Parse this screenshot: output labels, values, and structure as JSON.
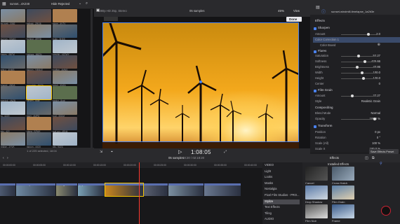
{
  "browser": {
    "title": "Hide Rejected",
    "clips_label": "sunset...4XZ48",
    "footer": "1 of 225 selected, 18:04",
    "thumb_labels": [
      "lsr-park...3382",
      "fallbdd...ZRQ8",
      "stone...4VTV",
      "la-nym...SSMG",
      "forbidd...8RRD",
      "trollp...9HSS",
      "hayes...4NFM",
      "highwa...M8ZN",
      "creshin...4ZZWY",
      "arts-c...4NMS",
      "lagoon...HANLE",
      "rooftop...4MNS",
      "chapel...4NDA",
      "mountain...4NZA",
      "cresh...4NZA",
      "gondoli...4NZB",
      "lunden...8ugt",
      "tundcr...8ugt",
      "lo...42Z9",
      "laser...4MPD",
      "roof...3SDM",
      "sky...4ZY",
      "plaza...SZWX",
      "surf-ocr...4RN4",
      "bridge...1YVK",
      "lagoon...44CK",
      "city...9ZZC"
    ]
  },
  "viewer": {
    "format": "1080p HD 25p, Stereo",
    "project": "05 samples",
    "zoom": "45%",
    "view": "View",
    "done": "Done",
    "timecode": "1:08:05"
  },
  "inspector": {
    "clip_name": "sunset-windmill-timelapse_1a2b3e",
    "sections": {
      "effects": "Effects",
      "sharpen": "Sharpen",
      "color_correction": "Color Correction 1",
      "color_board": "Color Board",
      "flares": "Flares",
      "film_grain": "Film Grain",
      "compositing": "Compositing",
      "transform": "Transform"
    },
    "rows": {
      "amount": "Amount",
      "amount_v": "2.0",
      "saturation": "Saturation",
      "saturation_v": "52.27",
      "softness": "Softness",
      "softness_v": "425.66",
      "brightness": "Brightness",
      "brightness_v": "43.86",
      "width": "Width",
      "width_v": "100.0",
      "height": "Height",
      "height_v": "120.0",
      "center": "Center",
      "center_x": "0",
      "grain_amount": "Amount",
      "grain_amount_v": "27.27",
      "grain_style": "Style",
      "grain_style_v": "Realistic Grain",
      "blend": "Blend Mode",
      "blend_v": "Normal",
      "opacity": "Opacity",
      "opacity_v": "100.0 %",
      "position": "Position",
      "position_v": "0 px",
      "rotation": "Rotation",
      "rotation_v": "0 °",
      "scale_all": "Scale (All)",
      "scale_all_v": "100 %",
      "scale_x": "Scale X",
      "scale_x_v": "100.0 %"
    },
    "save_preset": "Save Effects Preset"
  },
  "timeline": {
    "project": "05 samples",
    "duration": "18:20 / 02:18:20",
    "ruler": [
      "00:00:00:00",
      "00:00:05:00",
      "00:00:10:00",
      "00:00:15:00",
      "00:00:20:00",
      "00:00:25:00",
      "00:00:30:00",
      "00:00:35:00",
      "00:00:40:00"
    ],
    "clips": [
      "...eral...",
      "cross-country-beach...",
      "building-aweet...",
      "lipsy-beach-sd...",
      "sunset-windmill...",
      "beach-Jrefrte...",
      "le-wonder-shot-aweet...",
      "beach-bowls-..."
    ]
  },
  "effects_browser": {
    "title": "Effects",
    "installed": "Installed Effects",
    "categories": [
      "VIDEO",
      "Light",
      "Looks",
      "Masks",
      "Nostalgia",
      "Pixel Film Studios - PRO...",
      "Stylize",
      "Text Effects",
      "Tiling",
      "AUDIO"
    ],
    "items": [
      "Cancel",
      "Cross Hatch",
      "Drop Shadow",
      "Film Grain",
      "Film Noir",
      "Frame"
    ],
    "count": "24 items"
  },
  "colors": {
    "accent": "#f5a623",
    "selection": "#3b82f6",
    "clip_blue": "#5a6fb0"
  }
}
